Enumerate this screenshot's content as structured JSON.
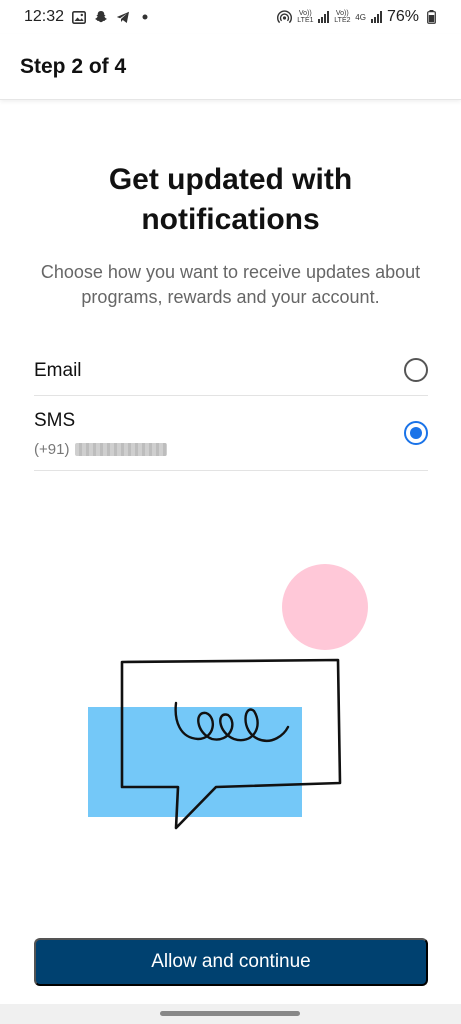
{
  "status_bar": {
    "time": "12:32",
    "battery": "76%",
    "sim1_label": "Vo)) LTE1",
    "sim2_label": "Vo)) LTE2",
    "net_label": "4G",
    "icons": [
      "gallery-icon",
      "snapchat-icon",
      "telegram-icon",
      "dot-icon",
      "hotspot-icon",
      "signal-icon",
      "battery-icon"
    ]
  },
  "header": {
    "step": "Step 2 of 4"
  },
  "main": {
    "title_line1": "Get updated with",
    "title_line2": "notifications",
    "subtitle": "Choose how you want to receive updates about programs, rewards and your account."
  },
  "options": {
    "email": {
      "label": "Email",
      "selected": false
    },
    "sms": {
      "label": "SMS",
      "country_code": "(+91)",
      "selected": true
    }
  },
  "illustration": {
    "colors": {
      "pink": "#FFC8D8",
      "blue": "#74C8F8",
      "line": "#111111"
    }
  },
  "footer": {
    "cta_label": "Allow and continue",
    "cta_color": "#004170"
  }
}
